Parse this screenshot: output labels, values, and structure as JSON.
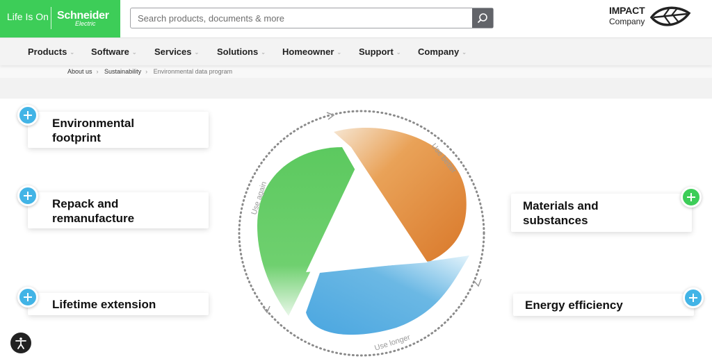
{
  "header": {
    "tagline": "Life Is On",
    "brand": "Schneider",
    "brand_sub": "Electric",
    "search_placeholder": "Search products, documents & more",
    "impact_line1": "IMPACT",
    "impact_line2": "Company"
  },
  "nav": {
    "items": [
      "Products",
      "Software",
      "Services",
      "Solutions",
      "Homeowner",
      "Support",
      "Company"
    ]
  },
  "breadcrumb": [
    "About us",
    "Sustainability",
    "Environmental data program"
  ],
  "cards": {
    "left": [
      {
        "line1": "Environmental",
        "line2": "footprint"
      },
      {
        "line1": "Repack and",
        "line2": "remanufacture"
      },
      {
        "line1": "Lifetime extension",
        "line2": ""
      }
    ],
    "right": [
      {
        "line1": "Materials and",
        "line2": "substances"
      },
      {
        "line1": "Energy efficiency",
        "line2": ""
      }
    ]
  },
  "cycle_labels": [
    "Use better",
    "Use again",
    "Use longer"
  ],
  "colors": {
    "brand_green": "#3dcd58",
    "orange": "#e47f00",
    "blue": "#42b4e6",
    "plus_blue": "#42b4e6",
    "plus_green": "#3dcd58"
  }
}
